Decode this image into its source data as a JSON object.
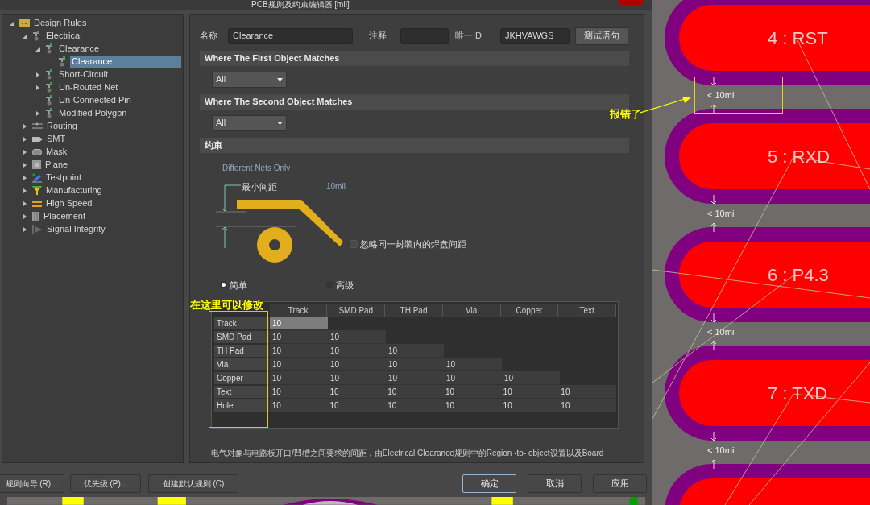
{
  "window": {
    "title": "PCB规则及约束编辑器 [mil]"
  },
  "tree": [
    {
      "label": "Design Rules",
      "kind": "folder",
      "expandable": true,
      "expanded": true,
      "selected": false,
      "children": [
        {
          "label": "Electrical",
          "kind": "rule",
          "expandable": true,
          "expanded": true,
          "selected": false,
          "children": [
            {
              "label": "Clearance",
              "kind": "rule",
              "expandable": true,
              "expanded": true,
              "selected": false,
              "children": [
                {
                  "label": "Clearance",
                  "kind": "rule",
                  "expandable": false,
                  "expanded": false,
                  "selected": true
                }
              ]
            },
            {
              "label": "Short-Circuit",
              "kind": "rule",
              "expandable": true,
              "expanded": false,
              "selected": false
            },
            {
              "label": "Un-Routed Net",
              "kind": "rule",
              "expandable": true,
              "expanded": false,
              "selected": false
            },
            {
              "label": "Un-Connected Pin",
              "kind": "rule",
              "expandable": false,
              "expanded": false,
              "selected": false
            },
            {
              "label": "Modified Polygon",
              "kind": "rule",
              "expandable": true,
              "expanded": false,
              "selected": false
            }
          ]
        },
        {
          "label": "Routing",
          "kind": "routing",
          "expandable": true,
          "expanded": false,
          "selected": false
        },
        {
          "label": "SMT",
          "kind": "smt",
          "expandable": true,
          "expanded": false,
          "selected": false
        },
        {
          "label": "Mask",
          "kind": "mask",
          "expandable": true,
          "expanded": false,
          "selected": false
        },
        {
          "label": "Plane",
          "kind": "plane",
          "expandable": true,
          "expanded": false,
          "selected": false
        },
        {
          "label": "Testpoint",
          "kind": "testpoint",
          "expandable": true,
          "expanded": false,
          "selected": false
        },
        {
          "label": "Manufacturing",
          "kind": "manufacturing",
          "expandable": true,
          "expanded": false,
          "selected": false
        },
        {
          "label": "High Speed",
          "kind": "highspeed",
          "expandable": true,
          "expanded": false,
          "selected": false
        },
        {
          "label": "Placement",
          "kind": "placement",
          "expandable": true,
          "expanded": false,
          "selected": false
        },
        {
          "label": "Signal Integrity",
          "kind": "signal",
          "expandable": true,
          "expanded": false,
          "selected": false
        }
      ]
    }
  ],
  "rule": {
    "name_label": "名称",
    "name": "Clearance",
    "comment_label": "注释",
    "id_label": "唯一ID",
    "id": "JKHVAWGS",
    "test_button": "测试语句",
    "first_header": "Where The First Object Matches",
    "first_value": "All",
    "second_header": "Where The Second Object Matches",
    "second_value": "All",
    "constraints_header": "约束",
    "net_scope": "Different Nets Only",
    "min_label": "最小间距",
    "min_value": "10mil",
    "ignore_pads": {
      "label": "忽略同一封装内的焊盘间距",
      "checked": false
    },
    "modes": [
      {
        "label": "简单",
        "selected": true
      },
      {
        "label": "高级",
        "selected": false
      }
    ],
    "description": "电气对象与电路板开口/凹槽之间要求的间距，由Electrical Clearance规则中的Region -to- object设置以及Board"
  },
  "table": {
    "columns": [
      "Track",
      "SMD Pad",
      "TH Pad",
      "Via",
      "Copper",
      "Text"
    ],
    "rows": [
      {
        "label": "Track",
        "cells": [
          {
            "value": "10",
            "selected": true
          }
        ]
      },
      {
        "label": "SMD Pad",
        "cells": [
          {
            "value": "10",
            "selected": false
          },
          {
            "value": "10",
            "selected": false
          }
        ]
      },
      {
        "label": "TH Pad",
        "cells": [
          {
            "value": "10",
            "selected": false
          },
          {
            "value": "10",
            "selected": false
          },
          {
            "value": "10",
            "selected": false
          }
        ]
      },
      {
        "label": "Via",
        "cells": [
          {
            "value": "10",
            "selected": false
          },
          {
            "value": "10",
            "selected": false
          },
          {
            "value": "10",
            "selected": false
          },
          {
            "value": "10",
            "selected": false
          }
        ]
      },
      {
        "label": "Copper",
        "cells": [
          {
            "value": "10",
            "selected": false
          },
          {
            "value": "10",
            "selected": false
          },
          {
            "value": "10",
            "selected": false
          },
          {
            "value": "10",
            "selected": false
          },
          {
            "value": "10",
            "selected": false
          }
        ]
      },
      {
        "label": "Text",
        "cells": [
          {
            "value": "10",
            "selected": false
          },
          {
            "value": "10",
            "selected": false
          },
          {
            "value": "10",
            "selected": false
          },
          {
            "value": "10",
            "selected": false
          },
          {
            "value": "10",
            "selected": false
          },
          {
            "value": "10",
            "selected": false
          }
        ]
      },
      {
        "label": "Hole",
        "cells": [
          {
            "value": "10",
            "selected": false
          },
          {
            "value": "10",
            "selected": false
          },
          {
            "value": "10",
            "selected": false
          },
          {
            "value": "10",
            "selected": false
          },
          {
            "value": "10",
            "selected": false
          },
          {
            "value": "10",
            "selected": false
          }
        ]
      }
    ]
  },
  "left_buttons": [
    "规则向导 (R)...",
    "优先级 (P)...",
    "创建默认规则 (C)"
  ],
  "right_buttons": [
    {
      "label": "确定",
      "default": true
    },
    {
      "label": "取消",
      "default": false
    },
    {
      "label": "应用",
      "default": false
    }
  ],
  "pcb": {
    "pads": [
      {
        "kind": "pad",
        "label": "4 : RST"
      },
      {
        "kind": "pad",
        "label": "5 : RXD"
      },
      {
        "kind": "pad",
        "label": "6 : P4.3"
      },
      {
        "kind": "pad",
        "label": "7 : TXD"
      },
      {
        "kind": "pad"
      }
    ],
    "gaps": [
      {
        "label": "< 10mil",
        "highlighted": true
      },
      {
        "label": "< 10mil",
        "highlighted": false
      },
      {
        "label": "< 10mil",
        "highlighted": false
      },
      {
        "label": "< 10mil",
        "highlighted": false
      }
    ]
  },
  "annotations": [
    {
      "kind": "error-callout",
      "text": "报错了"
    },
    {
      "kind": "edit-callout",
      "text": "在这里可以修改"
    }
  ]
}
